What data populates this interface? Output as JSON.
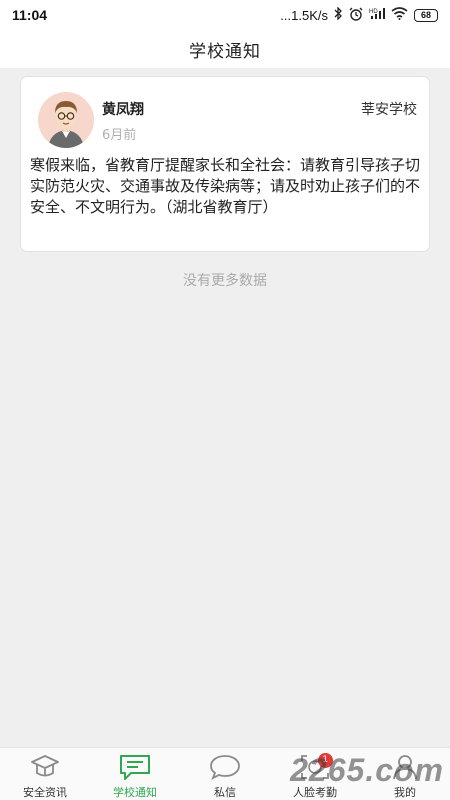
{
  "status_bar": {
    "time": "11:04",
    "network_speed": "...1.5K/s",
    "battery": "68",
    "icons": [
      "bluetooth-icon",
      "alarm-icon",
      "hd-signal-icon",
      "wifi-icon",
      "battery-icon"
    ]
  },
  "header": {
    "title": "学校通知"
  },
  "notice": {
    "author": "黄凤翔",
    "time": "6月前",
    "school": "莘安学校",
    "content": "寒假来临，省教育厅提醒家长和全社会：请教育引导孩子切实防范火灾、交通事故及传染病等；请及时劝止孩子们的不安全、不文明行为。（湖北省教育厅）"
  },
  "list_footer": "没有更多数据",
  "bottom_nav": {
    "items": [
      {
        "label": "安全资讯",
        "icon": "graduation-cap-icon"
      },
      {
        "label": "学校通知",
        "icon": "message-square-icon"
      },
      {
        "label": "私信",
        "icon": "chat-bubble-icon"
      },
      {
        "label": "人脸考勤",
        "icon": "face-scan-icon",
        "badge": "1"
      },
      {
        "label": "我的",
        "icon": "person-icon"
      }
    ],
    "active_index": 1,
    "active_color": "#2fa84f"
  },
  "watermark": "2265.com"
}
